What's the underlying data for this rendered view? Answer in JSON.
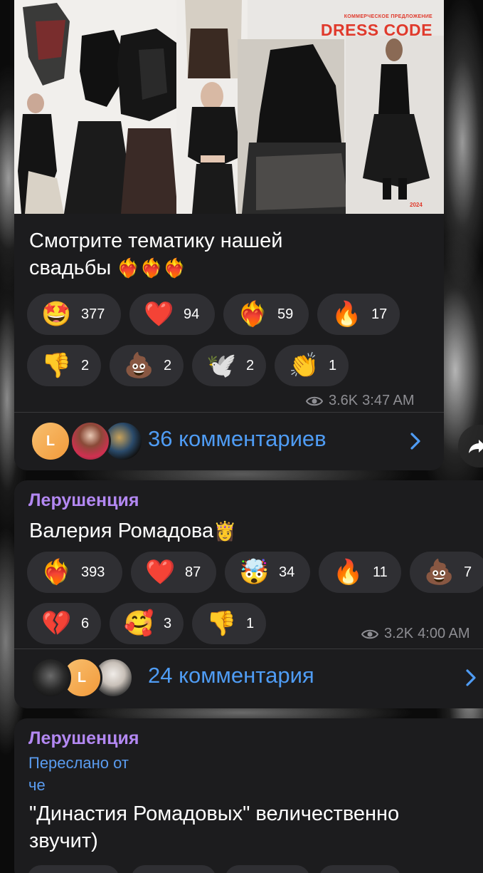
{
  "messages": [
    {
      "image": {
        "brand_sub": "КОММЕРЧЕСКОЕ ПРЕДЛОЖЕНИЕ",
        "brand": "DRESS CODE",
        "year": "2024"
      },
      "text_line1": "Смотрите тематику нашей",
      "text_line2": "свадьбы",
      "text_emoji": "❤️‍🔥❤️‍🔥❤️‍🔥",
      "reactions": [
        {
          "emoji": "🤩",
          "count": "377"
        },
        {
          "emoji": "❤️",
          "count": "94"
        },
        {
          "emoji": "❤️‍🔥",
          "count": "59"
        },
        {
          "emoji": "🔥",
          "count": "17"
        },
        {
          "emoji": "👎",
          "count": "2"
        },
        {
          "emoji": "💩",
          "count": "2"
        },
        {
          "emoji": "🕊️",
          "count": "2"
        },
        {
          "emoji": "👏",
          "count": "1"
        }
      ],
      "views": "3.6K",
      "time": "3:47 AM",
      "avatar_letter": "L",
      "comments": "36 комментариев"
    },
    {
      "sender": "Лерушенция",
      "text": "Валерия Ромадова",
      "text_emoji": "👸",
      "reactions": [
        {
          "emoji": "❤️‍🔥",
          "count": "393"
        },
        {
          "emoji": "❤️",
          "count": "87"
        },
        {
          "emoji": "🤯",
          "count": "34"
        },
        {
          "emoji": "🔥",
          "count": "11"
        },
        {
          "emoji": "💩",
          "count": "7"
        },
        {
          "emoji": "💔",
          "count": "6"
        },
        {
          "emoji": "🥰",
          "count": "3"
        },
        {
          "emoji": "👎",
          "count": "1"
        }
      ],
      "views": "3.2K",
      "time": "4:00 AM",
      "avatar_letter": "L",
      "comments": "24 комментария"
    },
    {
      "sender": "Лерушенция",
      "forwarded_line1": "Переслано от",
      "forwarded_line2": "че",
      "text_line1": "\"Династия Ромадовых\" величественно",
      "text_line2": "звучит)"
    }
  ],
  "icons": {
    "views": "eye-icon",
    "comments": "chevron-right-icon",
    "share": "share-icon"
  },
  "colors": {
    "bubble": "#1c1c1e",
    "reaction": "#2f2f33",
    "link": "#4f9cf4",
    "sender": "#b388f2",
    "meta": "#8e8e93"
  }
}
